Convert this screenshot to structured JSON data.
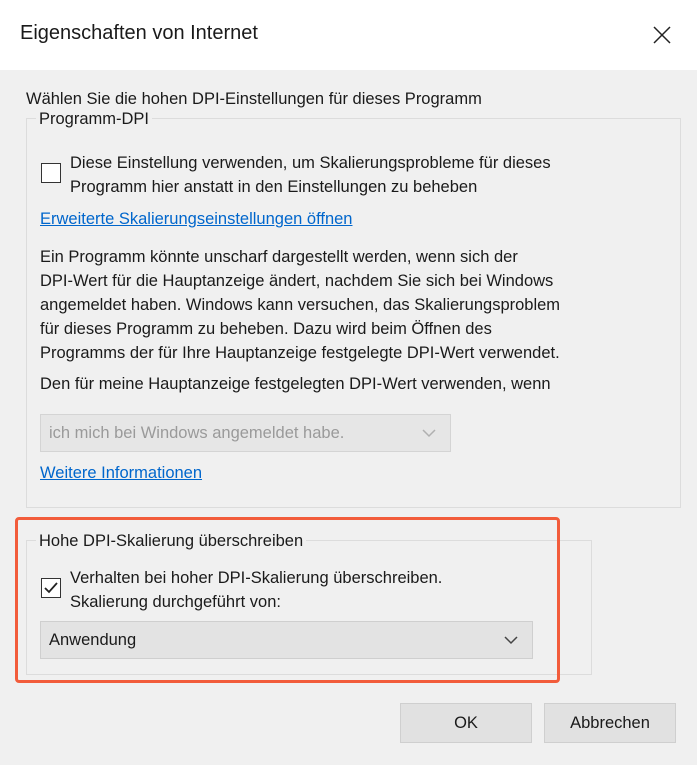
{
  "window": {
    "title": "Eigenschaften von Internet"
  },
  "heading": "Wählen Sie die hohen DPI-Einstellungen für dieses Programm",
  "group_program_dpi": {
    "label": "Programm-DPI",
    "checkbox": {
      "checked": false,
      "label_line1": "Diese Einstellung verwenden, um Skalierungsprobleme für dieses",
      "label_line2": "Programm hier anstatt in den Einstellungen zu beheben"
    },
    "advanced_link": "Erweiterte Skalierungseinstellungen öffnen",
    "description_lines": [
      "Ein Programm könnte unscharf dargestellt werden, wenn sich der",
      "DPI-Wert für die Hauptanzeige ändert, nachdem Sie sich bei Windows",
      "angemeldet haben. Windows kann versuchen, das Skalierungsproblem",
      "für dieses Programm zu beheben. Dazu wird beim Öffnen des",
      "Programms der für Ihre Hauptanzeige festgelegte DPI-Wert verwendet."
    ],
    "use_dpi_text": "Den für meine Hauptanzeige festgelegten DPI-Wert verwenden, wenn",
    "dpi_select": {
      "value": "ich mich bei Windows angemeldet habe.",
      "disabled": true
    },
    "more_info_link": "Weitere Informationen"
  },
  "group_override": {
    "label": "Hohe DPI-Skalierung überschreiben",
    "checkbox": {
      "checked": true,
      "label_line1": "Verhalten bei hoher DPI-Skalierung überschreiben.",
      "label_line2": "Skalierung durchgeführt von:"
    },
    "scaling_select": {
      "value": "Anwendung"
    }
  },
  "buttons": {
    "ok": "OK",
    "cancel": "Abbrechen"
  },
  "colors": {
    "highlight": "#f25c3b",
    "link": "#0066cc",
    "dialog_bg": "#f0f0f0"
  },
  "icons": {
    "close": "close-icon",
    "dropdown": "chevron-down-icon",
    "check": "checkmark-icon"
  }
}
